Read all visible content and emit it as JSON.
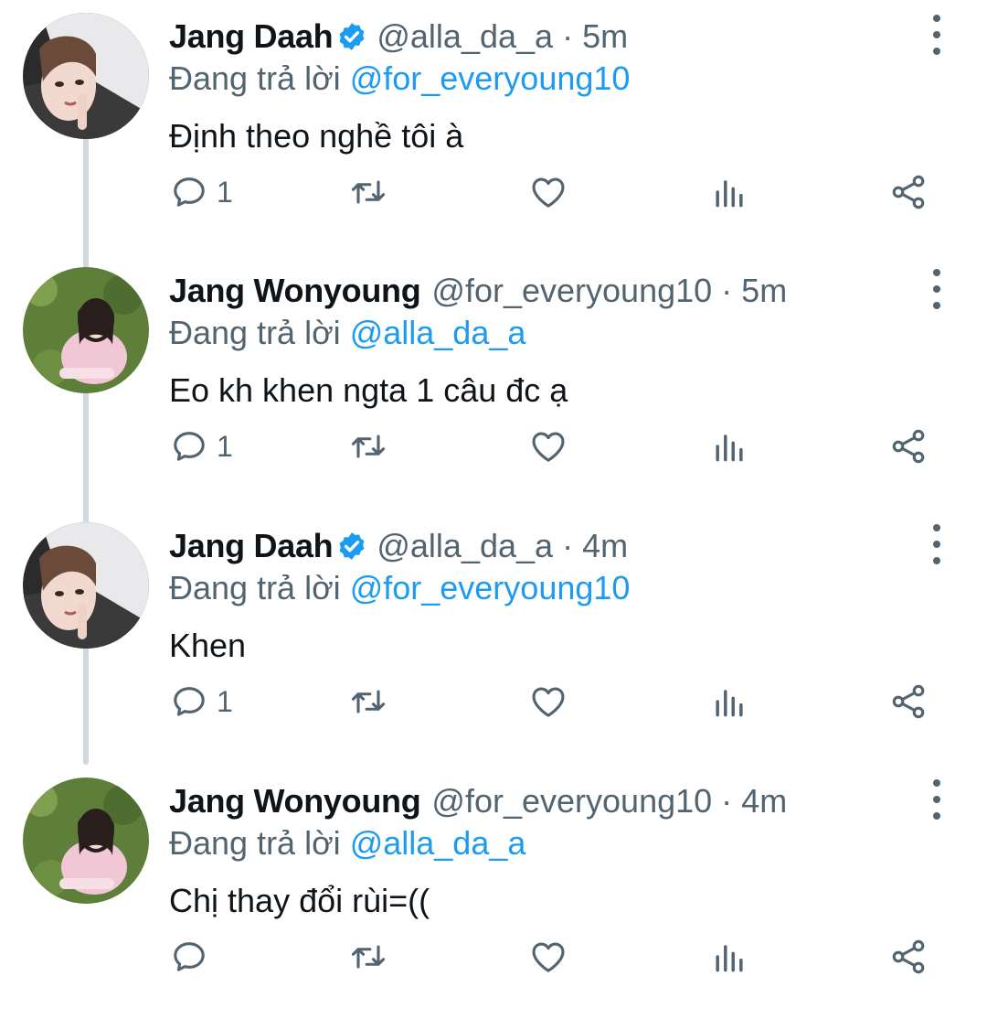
{
  "tweets": [
    {
      "name": "Jang Daah",
      "verified": true,
      "handle": "@alla_da_a",
      "dot": "·",
      "time": "5m",
      "reply_prefix": "Đang trả lời ",
      "reply_mention": "@for_everyoung10",
      "text": "Định theo nghề tôi à",
      "reply_count": "1"
    },
    {
      "name": "Jang Wonyoung",
      "verified": false,
      "handle": "@for_everyoung10",
      "dot": "·",
      "time": "5m",
      "reply_prefix": "Đang trả lời ",
      "reply_mention": "@alla_da_a",
      "text": "Eo kh khen ngta 1 câu đc ạ",
      "reply_count": "1"
    },
    {
      "name": "Jang Daah",
      "verified": true,
      "handle": "@alla_da_a",
      "dot": "·",
      "time": "4m",
      "reply_prefix": "Đang trả lời ",
      "reply_mention": "@for_everyoung10",
      "text": "Khen",
      "reply_count": "1"
    },
    {
      "name": "Jang Wonyoung",
      "verified": false,
      "handle": "@for_everyoung10",
      "dot": "·",
      "time": "4m",
      "reply_prefix": "Đang trả lời ",
      "reply_mention": "@alla_da_a",
      "text": "Chị thay đổi rùi=((",
      "reply_count": ""
    }
  ],
  "icons": {
    "verified": "verified-badge-icon",
    "more": "more-vertical-icon",
    "reply": "reply-bubble-icon",
    "retweet": "retweet-icon",
    "like": "heart-icon",
    "views": "analytics-icon",
    "share": "share-icon"
  },
  "colors": {
    "name": "#0f1419",
    "secondary": "#536471",
    "mention": "#1d9bf0",
    "verified": "#1d9bf0",
    "thread_line": "#cfd9de"
  }
}
